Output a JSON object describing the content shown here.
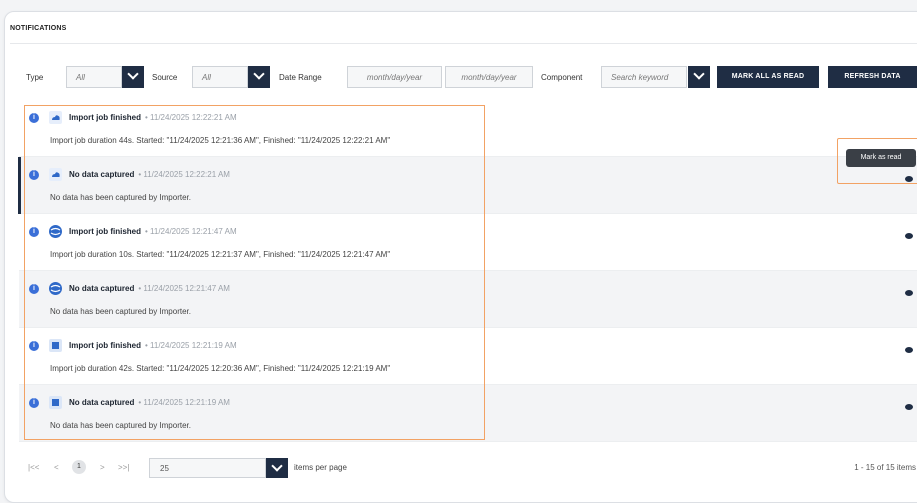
{
  "header": {
    "title": "NOTIFICATIONS"
  },
  "filters": {
    "type_label": "Type",
    "type_value": "All",
    "source_label": "Source",
    "source_value": "All",
    "date_range_label": "Date Range",
    "date_from_placeholder": "month/day/year",
    "date_to_placeholder": "month/day/year",
    "component_label": "Component",
    "component_placeholder": "Search keyword"
  },
  "actions": {
    "mark_all_read": "MARK ALL AS READ",
    "refresh": "REFRESH DATA"
  },
  "tooltip": {
    "mark_as_read": "Mark as read"
  },
  "notifications": [
    {
      "title": "Import job finished",
      "timestamp": "• 11/24/2025 12:22:21 AM",
      "description": "Import job duration 44s. Started: \"11/24/2025 12:21:36 AM\", Finished: \"11/24/2025 12:22:21 AM\"",
      "source_icon": "cloud-icon"
    },
    {
      "title": "No data captured",
      "timestamp": "• 11/24/2025 12:22:21 AM",
      "description": "No data has been captured by Importer.",
      "source_icon": "cloud-icon"
    },
    {
      "title": "Import job finished",
      "timestamp": "• 11/24/2025 12:21:47 AM",
      "description": "Import job duration 10s. Started: \"11/24/2025 12:21:37 AM\", Finished: \"11/24/2025 12:21:47 AM\"",
      "source_icon": "globe-icon"
    },
    {
      "title": "No data captured",
      "timestamp": "• 11/24/2025 12:21:47 AM",
      "description": "No data has been captured by Importer.",
      "source_icon": "globe-icon"
    },
    {
      "title": "Import job finished",
      "timestamp": "• 11/24/2025 12:21:19 AM",
      "description": "Import job duration 42s. Started: \"11/24/2025 12:20:36 AM\", Finished: \"11/24/2025 12:21:19 AM\"",
      "source_icon": "outlook-icon"
    },
    {
      "title": "No data captured",
      "timestamp": "• 11/24/2025 12:21:19 AM",
      "description": "No data has been captured by Importer.",
      "source_icon": "outlook-icon"
    }
  ],
  "pagination": {
    "first": "|<<",
    "prev": "<",
    "current_page": "1",
    "next": ">",
    "last": ">>|",
    "per_page_value": "25",
    "per_page_label": "items per page",
    "count": "1 - 15 of 15 items"
  },
  "colors": {
    "primary": "#1f2d44",
    "info": "#3a6fd8",
    "highlight": "#f2a264"
  }
}
